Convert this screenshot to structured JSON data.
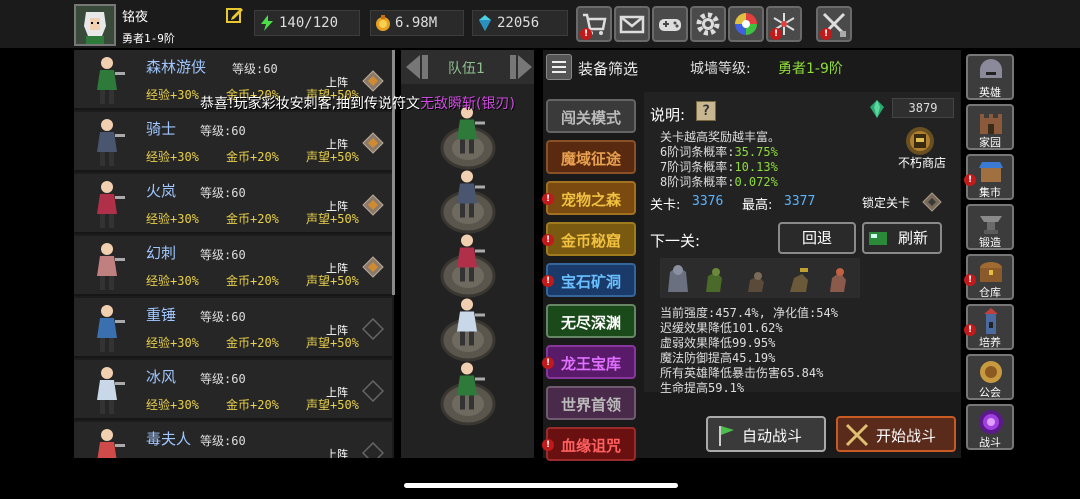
{
  "player": {
    "name": "铭夜",
    "rank": "勇者1-9阶"
  },
  "stats": {
    "energy": "140/120",
    "gold": "6.98M",
    "gems": "22056"
  },
  "top_buttons": [
    {
      "name": "shop-cart-icon",
      "badge": true
    },
    {
      "name": "mail-icon",
      "badge": false
    },
    {
      "name": "gamepad-icon",
      "badge": false
    },
    {
      "name": "settings-gear-icon",
      "badge": false
    },
    {
      "name": "color-wheel-icon",
      "badge": false
    },
    {
      "name": "fireworks-icon",
      "badge": true
    },
    {
      "name": "swords-tool-icon",
      "badge": true
    }
  ],
  "heroes": [
    {
      "name": "森林游侠",
      "level_label": "等级:",
      "level": "60",
      "exp": "经验+30%",
      "gold": "金币+20%",
      "fame": "声望+50%",
      "action": "上阵",
      "color": "#2e7a3a"
    },
    {
      "name": "骑士",
      "level_label": "等级:",
      "level": "60",
      "exp": "经验+30%",
      "gold": "金币+20%",
      "fame": "声望+50%",
      "action": "上阵",
      "color": "#4a5670"
    },
    {
      "name": "火岚",
      "level_label": "等级:",
      "level": "60",
      "exp": "经验+30%",
      "gold": "金币+20%",
      "fame": "声望+50%",
      "action": "上阵",
      "color": "#b0304a"
    },
    {
      "name": "幻刺",
      "level_label": "等级:",
      "level": "60",
      "exp": "经验+30%",
      "gold": "金币+20%",
      "fame": "声望+50%",
      "action": "上阵",
      "color": "#c08080"
    },
    {
      "name": "重锤",
      "level_label": "等级:",
      "level": "60",
      "exp": "经验+30%",
      "gold": "金币+20%",
      "fame": "声望+50%",
      "action": "上阵",
      "color": "#3a6fb0"
    },
    {
      "name": "冰风",
      "level_label": "等级:",
      "level": "60",
      "exp": "经验+30%",
      "gold": "金币+20%",
      "fame": "声望+50%",
      "action": "上阵",
      "color": "#c8d8e8"
    },
    {
      "name": "毒夫人",
      "level_label": "等级:",
      "level": "60",
      "exp": "",
      "gold": "",
      "fame": "",
      "action": "上阵",
      "color": "#d04a4a"
    }
  ],
  "team": {
    "label": "队伍1"
  },
  "filter_label": "装备筛选",
  "wall": {
    "label": "城墙等级:",
    "value": "勇者1-9阶"
  },
  "modes": [
    {
      "label": "闯关模式",
      "bg": "#3a3a3a",
      "fg": "#bbbbbb",
      "badge": false
    },
    {
      "label": "魔域征途",
      "bg": "#5a2a10",
      "fg": "#e8a050",
      "badge": false
    },
    {
      "label": "宠物之森",
      "bg": "#7a4a10",
      "fg": "#f0c040",
      "badge": true
    },
    {
      "label": "金币秘窟",
      "bg": "#7a5a10",
      "fg": "#f0c040",
      "badge": true
    },
    {
      "label": "宝石矿洞",
      "bg": "#1a3a6a",
      "fg": "#6ac0ff",
      "badge": true
    },
    {
      "label": "无尽深渊",
      "bg": "#1a4a1a",
      "fg": "#ffffff",
      "badge": false
    },
    {
      "label": "龙王宝库",
      "bg": "#5a1a6a",
      "fg": "#e070ff",
      "badge": true
    },
    {
      "label": "世界首领",
      "bg": "#4a2a4a",
      "fg": "#bbbbbb",
      "badge": false
    },
    {
      "label": "血缘诅咒",
      "bg": "#6a1010",
      "fg": "#ff6060",
      "badge": true
    }
  ],
  "info": {
    "desc_label": "说明:",
    "desc_icon": "?",
    "gems": "3879",
    "line1": "关卡越高奖励越丰富。",
    "p6_label": "6阶词条概率:",
    "p6": "35.75%",
    "p7_label": "7阶词条概率:",
    "p7": "10.13%",
    "p8_label": "8阶词条概率:",
    "p8": "0.072%",
    "shop": "不朽商店",
    "level_label": "关卡:",
    "level": "3376",
    "best_label": "最高:",
    "best": "3377",
    "lock_label": "锁定关卡",
    "next_label": "下一关:",
    "back_btn": "回退",
    "refresh_btn": "刷新",
    "effects": [
      "当前强度:457.4%, 净化值:54%",
      "迟缓效果降低101.62%",
      "虚弱效果降低99.95%",
      "魔法防御提高45.19%",
      "所有英雄降低暴击伤害65.84%",
      "生命提高59.1%"
    ],
    "auto_btn": "自动战斗",
    "start_btn": "开始战斗"
  },
  "side_menu": [
    {
      "label": "英雄",
      "icon": "helmet-icon",
      "badge": false
    },
    {
      "label": "家园",
      "icon": "castle-icon",
      "badge": false
    },
    {
      "label": "集市",
      "icon": "market-icon",
      "badge": true
    },
    {
      "label": "锻造",
      "icon": "anvil-icon",
      "badge": false
    },
    {
      "label": "仓库",
      "icon": "chest-icon",
      "badge": true
    },
    {
      "label": "培养",
      "icon": "tower-icon",
      "badge": true
    },
    {
      "label": "公会",
      "icon": "guild-icon",
      "badge": false
    },
    {
      "label": "战斗",
      "icon": "portal-icon",
      "badge": false
    }
  ],
  "notice": {
    "prefix": "恭喜!玩家彩妆安刺客,抽到传说符文",
    "item": "无敌瞬斩(银刃)"
  }
}
